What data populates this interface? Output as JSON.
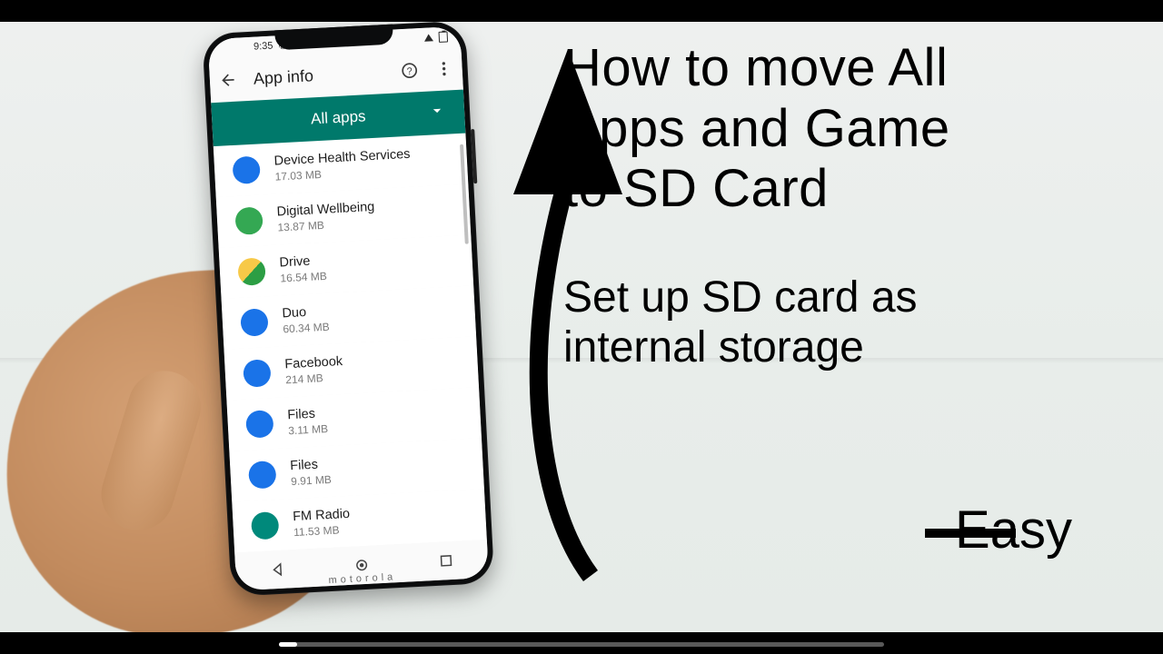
{
  "overlay": {
    "title_line1": "How to move All",
    "title_line2": "Apps and Game",
    "title_line3": "to SD Card",
    "subtitle_line1": "Set up SD card as",
    "subtitle_line2": "internal storage",
    "easy_label": "Easy"
  },
  "phone": {
    "brand": "motorola",
    "statusbar": {
      "time": "9:35"
    },
    "appbar": {
      "title": "App info"
    },
    "filter": {
      "label": "All apps"
    },
    "apps": [
      {
        "name": "Device Health Services",
        "size": "17.03 MB",
        "icon": "device-health-icon",
        "bg": "bg-blue"
      },
      {
        "name": "Digital Wellbeing",
        "size": "13.87 MB",
        "icon": "wellbeing-icon",
        "bg": "bg-green"
      },
      {
        "name": "Drive",
        "size": "16.54 MB",
        "icon": "drive-icon",
        "bg": "bg-yellow"
      },
      {
        "name": "Duo",
        "size": "60.34 MB",
        "icon": "duo-icon",
        "bg": "bg-indigo"
      },
      {
        "name": "Facebook",
        "size": "214 MB",
        "icon": "facebook-icon",
        "bg": "bg-blue"
      },
      {
        "name": "Files",
        "size": "3.11 MB",
        "icon": "files-icon",
        "bg": "bg-folder"
      },
      {
        "name": "Files",
        "size": "9.91 MB",
        "icon": "files-go-icon",
        "bg": "bg-folder"
      },
      {
        "name": "FM Radio",
        "size": "11.53 MB",
        "icon": "fm-radio-icon",
        "bg": "bg-radio"
      }
    ]
  },
  "video": {
    "scrub_percent": 3
  }
}
